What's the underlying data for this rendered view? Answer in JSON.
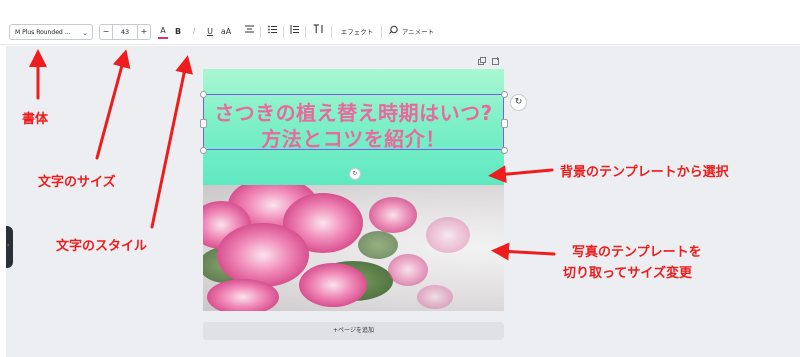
{
  "toolbar": {
    "font_name": "M Plus Rounded ...",
    "font_chevron": "⌄",
    "size_minus": "−",
    "size_value": "43",
    "size_plus": "+",
    "text_color": "A",
    "bold": "B",
    "italic": "I",
    "underline": "U",
    "case": "aA",
    "effect": "エフェクト",
    "animate": "アニメート"
  },
  "canvas": {
    "title_line1": "さつきの植え替え時期はいつ?",
    "title_line2": "方法とコツを紹介！",
    "add_page": "+ページを追加"
  },
  "annotations": {
    "font": "書体",
    "size": "文字のサイズ",
    "style": "文字のスタイル",
    "background": "背景のテンプレートから選択",
    "photo_line1": "写真のテンプレートを",
    "photo_line2": "切り取ってサイズ変更"
  },
  "colors": {
    "annotation_red": "#ee1c1c",
    "title_pink": "#e76a9c",
    "banner_mint": "#7ff0c8",
    "selection_purple": "#7b5cf0"
  }
}
